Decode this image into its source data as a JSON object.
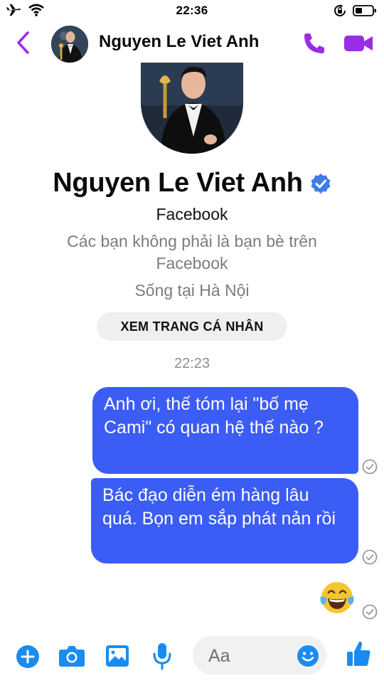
{
  "status_bar": {
    "time": "22:36",
    "icons": [
      "airplane-icon",
      "wifi-icon",
      "rotation-lock-icon",
      "battery-icon"
    ]
  },
  "header": {
    "contact_name": "Nguyen Le Viet Anh",
    "icons": [
      "back-chevron-icon",
      "phone-icon",
      "video-camera-icon"
    ]
  },
  "profile": {
    "name": "Nguyen Le Viet Anh",
    "source": "Facebook",
    "friend_status": "Các bạn không phải là bạn bè trên Facebook",
    "location": "Sống tại Hà Nội",
    "view_profile_button": "XEM TRANG CÁ NHÂN"
  },
  "conversation": {
    "timestamp": "22:23",
    "messages": [
      {
        "sender": "me",
        "text": "Anh ơi, thế tóm lại \"bố mẹ Cami\" có quan hệ thế nào ?",
        "status": "sent"
      },
      {
        "sender": "me",
        "text": "Bác đạo diễn ém hàng lâu quá. Bọn em sắp phát nản rồi",
        "status": "sent"
      },
      {
        "sender": "me",
        "emoji": "tears-of-joy-emoji",
        "status": "sent"
      }
    ]
  },
  "composer": {
    "placeholder": "Aa",
    "icons": [
      "plus-icon",
      "camera-icon",
      "image-icon",
      "microphone-icon",
      "emoji-icon",
      "thumbs-up-icon"
    ]
  },
  "colors": {
    "accent": "#9a2ce6",
    "bubble": "#3b5cf5",
    "toolbar_blue": "#1a8cf0",
    "verified": "#3f7ee6"
  }
}
